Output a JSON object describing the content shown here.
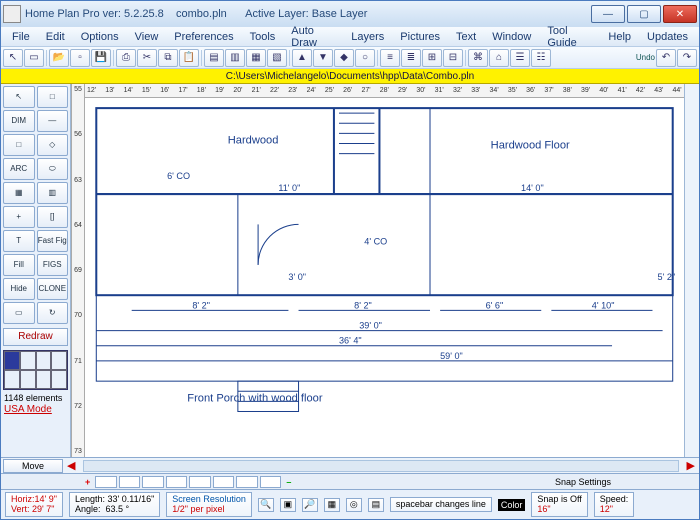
{
  "titlebar": {
    "app": "Home Plan Pro ver: 5.2.25.8",
    "file": "combo.pln",
    "layer_label": "Active Layer:",
    "layer": "Base Layer"
  },
  "menu": [
    "File",
    "Edit",
    "Options",
    "View",
    "Preferences",
    "Tools",
    "Auto Draw",
    "Layers",
    "Pictures",
    "Text",
    "Window",
    "Tool Guide",
    "Help",
    "Updates"
  ],
  "toolbar": {
    "undo": "Undo"
  },
  "pathbar": "C:\\Users\\Michelangelo\\Documents\\hpp\\Data\\Combo.pln",
  "hruler": [
    "12'",
    "13'",
    "14'",
    "15'",
    "16'",
    "17'",
    "18'",
    "19'",
    "20'",
    "21'",
    "22'",
    "23'",
    "24'",
    "25'",
    "26'",
    "27'",
    "28'",
    "29'",
    "30'",
    "31'",
    "32'",
    "33'",
    "34'",
    "35'",
    "36'",
    "37'",
    "38'",
    "39'",
    "40'",
    "41'",
    "42'",
    "43'",
    "44'"
  ],
  "vruler": [
    "55",
    "56",
    "63",
    "64",
    "69",
    "70",
    "71",
    "72",
    "73"
  ],
  "left": {
    "tools": [
      "↖",
      "□",
      "DIM",
      "—",
      "□",
      "◇",
      "ARC",
      "⬭",
      "▦",
      "▥",
      "+",
      "[]",
      "T",
      "Fast Fig",
      "Fill",
      "FIGS",
      "Hide",
      "CLONE",
      "▭",
      "↻"
    ],
    "redraw": "Redraw",
    "elements": "1148 elements",
    "usa": "USA Mode"
  },
  "plan": {
    "hardwood": "Hardwood",
    "hardwood_floor": "Hardwood Floor",
    "co6": "6' CO",
    "co4": "4' CO",
    "d11": "11' 0\"",
    "d14": "14' 0\"",
    "d3": "3' 0\"",
    "d82a": "8' 2\"",
    "d82b": "8' 2\"",
    "d66": "6' 6\"",
    "d410": "4' 10\"",
    "d52": "5' 2\"",
    "d39": "39' 0\"",
    "d364": "36' 4\"",
    "d59": "59' 0\"",
    "porch": "Front Porch with wood floor"
  },
  "scrollrow": {
    "move": "Move"
  },
  "tabrow": {
    "snap": "Snap Settings"
  },
  "status": {
    "horiz_lbl": "Horiz:",
    "horiz": "14' 9\"",
    "vert_lbl": "Vert:",
    "vert": "29' 7\"",
    "length_lbl": "Length:",
    "length": "33' 0.11/16\"",
    "angle_lbl": "Angle:",
    "angle": "63.5 °",
    "res_lbl": "Screen Resolution",
    "res": "1/2\" per pixel",
    "hint": "spacebar changes line",
    "color": "Color",
    "snap_lbl": "Snap is Off",
    "snap_val": "16\"",
    "speed_lbl": "Speed:",
    "speed": "12\""
  }
}
